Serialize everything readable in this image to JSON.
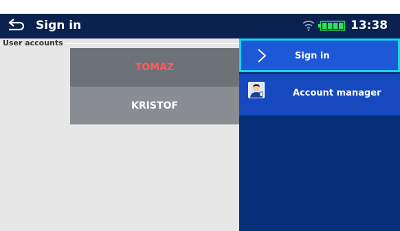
{
  "header": {
    "title": "Sign in",
    "time": "13:38",
    "icons": {
      "back": "back-arrow-icon",
      "wifi": "wifi-icon",
      "battery": "battery-icon"
    }
  },
  "accounts": {
    "section_title": "User accounts",
    "users": [
      {
        "name": "TOMAZ",
        "selected": true
      },
      {
        "name": "KRISTOF",
        "selected": false
      }
    ]
  },
  "menu": {
    "items": [
      {
        "label": "Sign in",
        "icon": "chevron-right-icon",
        "active": true
      },
      {
        "label": "Account manager",
        "icon": "account-manager-icon",
        "active": false
      }
    ]
  },
  "colors": {
    "header_bg": "#0b2150",
    "right_panel_bg": "#062f79",
    "active_item_bg": "#1d59d6",
    "active_border": "#15d7f0",
    "selected_user_text": "#ff5b5b",
    "battery_fill": "#2ce05a"
  }
}
